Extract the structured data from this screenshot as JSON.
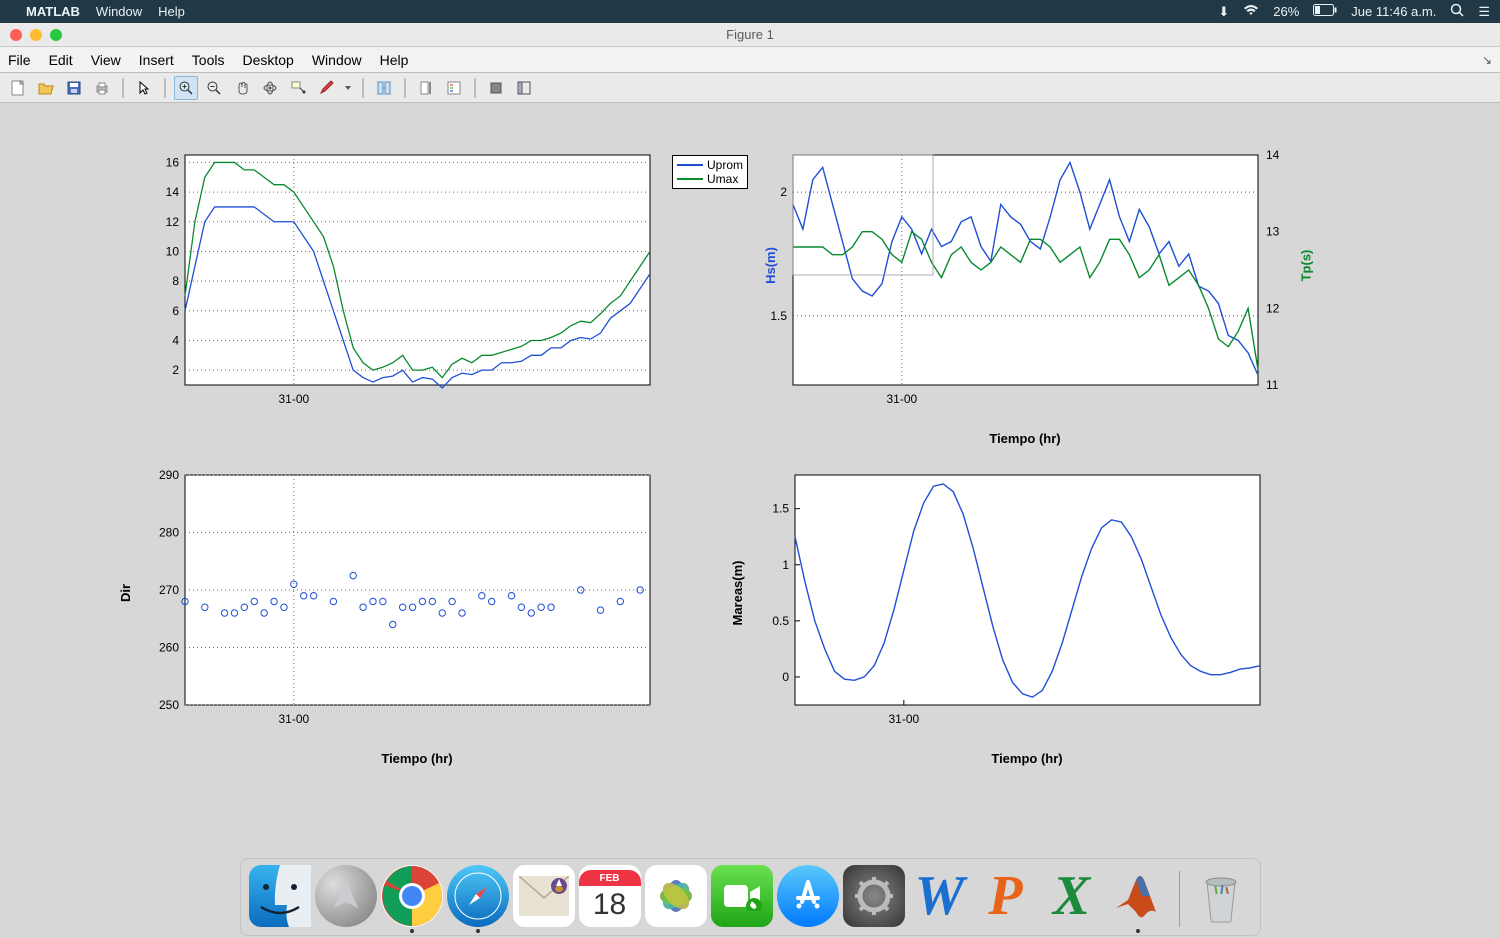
{
  "mac_menubar": {
    "app": "MATLAB",
    "menus": [
      "Window",
      "Help"
    ],
    "battery": "26%",
    "day_time": "Jue 11:46 a.m."
  },
  "window": {
    "title": "Figure 1"
  },
  "fig_menubar": {
    "items": [
      "File",
      "Edit",
      "View",
      "Insert",
      "Tools",
      "Desktop",
      "Window",
      "Help"
    ],
    "overflow": "↘"
  },
  "toolbar": {
    "items": [
      "new-figure-icon",
      "open-icon",
      "save-icon",
      "print-icon",
      "sep",
      "pointer-icon",
      "sep",
      "zoom-in-icon",
      "zoom-out-icon",
      "pan-icon",
      "rotate3d-icon",
      "data-cursor-icon",
      "brush-icon",
      "dropdown-arrow-icon",
      "sep",
      "link-axes-icon",
      "sep",
      "colorbar-icon",
      "legend-icon",
      "sep",
      "hide-tools-icon",
      "dock-icon"
    ]
  },
  "chart_data": [
    {
      "id": "wind_speed",
      "type": "line",
      "xlabel": "",
      "ylabel": "",
      "yticks": [
        2,
        4,
        6,
        8,
        10,
        12,
        14,
        16
      ],
      "xticks": [
        "31-00"
      ],
      "legend": [
        "Uprom",
        "Umax"
      ],
      "x": [
        0,
        1,
        2,
        3,
        4,
        5,
        6,
        7,
        8,
        9,
        10,
        11,
        12,
        13,
        14,
        15,
        16,
        17,
        18,
        19,
        20,
        21,
        22,
        23,
        24,
        25,
        26,
        27,
        28,
        29,
        30,
        31,
        32,
        33,
        34,
        35,
        36,
        37,
        38,
        39,
        40,
        41,
        42,
        43,
        44,
        45,
        46,
        47
      ],
      "series": [
        {
          "name": "Uprom",
          "color": "#1f4fd6",
          "values": [
            6,
            9,
            12,
            13,
            13,
            13,
            13,
            13,
            12.5,
            12,
            12,
            12,
            11,
            10,
            8,
            6,
            4,
            2,
            1.5,
            1.2,
            1.5,
            1.6,
            2,
            1.2,
            1.5,
            1.4,
            0.8,
            1.5,
            1.8,
            1.7,
            2,
            2,
            2.5,
            2.5,
            2.6,
            3,
            3,
            3.5,
            3.5,
            4,
            4.2,
            4.1,
            4.5,
            5.5,
            6,
            6.5,
            7.5,
            8.5
          ]
        },
        {
          "name": "Umax",
          "color": "#0a8a2f",
          "values": [
            7,
            12,
            15,
            16,
            16,
            16,
            15.5,
            15.5,
            15,
            14.5,
            14.5,
            14,
            13,
            12,
            11,
            9,
            6,
            3.5,
            2.5,
            2,
            2.2,
            2.5,
            3,
            2,
            2,
            2.2,
            1.5,
            2.4,
            2.8,
            2.5,
            3,
            3,
            3.2,
            3.4,
            3.6,
            4,
            4,
            4.2,
            4.5,
            5,
            5.3,
            5.2,
            5.8,
            6.5,
            7,
            8,
            9,
            10
          ]
        }
      ],
      "ylim": [
        1,
        16.5
      ]
    },
    {
      "id": "waves",
      "type": "line",
      "xlabel": "Tiempo (hr)",
      "yleft_label": "Hs(m)",
      "yright_label": "Tp(s)",
      "yleft_ticks": [
        1.5,
        2
      ],
      "yright_ticks": [
        11,
        12,
        13,
        14
      ],
      "yleft_color": "#1f4fd6",
      "yright_color": "#0a8a2f",
      "xticks": [
        "31-00"
      ],
      "x": [
        0,
        1,
        2,
        3,
        4,
        5,
        6,
        7,
        8,
        9,
        10,
        11,
        12,
        13,
        14,
        15,
        16,
        17,
        18,
        19,
        20,
        21,
        22,
        23,
        24,
        25,
        26,
        27,
        28,
        29,
        30,
        31,
        32,
        33,
        34,
        35,
        36,
        37,
        38,
        39,
        40,
        41,
        42,
        43,
        44,
        45,
        46,
        47
      ],
      "series": [
        {
          "name": "Hs",
          "axis": "left",
          "color": "#1f4fd6",
          "values": [
            1.95,
            1.85,
            2.05,
            2.1,
            1.95,
            1.8,
            1.65,
            1.6,
            1.58,
            1.63,
            1.8,
            1.9,
            1.85,
            1.75,
            1.85,
            1.78,
            1.8,
            1.88,
            1.9,
            1.78,
            1.72,
            1.95,
            1.9,
            1.87,
            1.8,
            1.77,
            1.9,
            2.05,
            2.12,
            2.0,
            1.85,
            1.95,
            2.05,
            1.9,
            1.8,
            1.93,
            1.86,
            1.75,
            1.8,
            1.7,
            1.75,
            1.62,
            1.6,
            1.55,
            1.42,
            1.4,
            1.35,
            1.26
          ],
          "ylim": [
            1.22,
            2.15
          ]
        },
        {
          "name": "Tp",
          "axis": "right",
          "color": "#0a8a2f",
          "values": [
            12.8,
            12.8,
            12.8,
            12.8,
            12.7,
            12.7,
            12.8,
            13.0,
            13.0,
            12.9,
            12.7,
            12.6,
            13.0,
            12.9,
            12.6,
            12.4,
            12.7,
            12.8,
            12.6,
            12.5,
            12.6,
            12.8,
            12.7,
            12.6,
            12.9,
            12.9,
            12.8,
            12.6,
            12.7,
            12.8,
            12.4,
            12.6,
            12.9,
            12.9,
            12.7,
            12.4,
            12.5,
            12.7,
            12.3,
            12.4,
            12.5,
            12.3,
            12.0,
            11.6,
            11.5,
            11.7,
            12.0,
            11.2
          ],
          "ylim": [
            11,
            14
          ]
        }
      ]
    },
    {
      "id": "direction",
      "type": "scatter",
      "xlabel": "Tiempo (hr)",
      "ylabel": "Dir",
      "yticks": [
        250,
        260,
        270,
        280,
        290
      ],
      "xticks": [
        "31-00"
      ],
      "color": "#1f4fd6",
      "x": [
        0,
        2,
        4,
        5,
        6,
        7,
        8,
        9,
        10,
        11,
        12,
        13,
        15,
        17,
        18,
        19,
        20,
        21,
        22,
        23,
        24,
        25,
        26,
        27,
        28,
        30,
        31,
        33,
        34,
        35,
        36,
        37,
        40,
        42,
        44,
        46
      ],
      "y": [
        268,
        267,
        266,
        266,
        267,
        268,
        266,
        268,
        267,
        271,
        269,
        269,
        268,
        272.5,
        267,
        268,
        268,
        264,
        267,
        267,
        268,
        268,
        266,
        268,
        266,
        269,
        268,
        269,
        267,
        266,
        267,
        267,
        270,
        266.5,
        268,
        270
      ],
      "ylim": [
        250,
        290
      ]
    },
    {
      "id": "tide",
      "type": "line",
      "xlabel": "Tiempo (hr)",
      "ylabel": "Mareas(m)",
      "yticks": [
        0,
        0.5,
        1,
        1.5
      ],
      "xticks": [
        "31-00"
      ],
      "color": "#1f4fd6",
      "x": [
        0,
        1,
        2,
        3,
        4,
        5,
        6,
        7,
        8,
        9,
        10,
        11,
        12,
        13,
        14,
        15,
        16,
        17,
        18,
        19,
        20,
        21,
        22,
        23,
        24,
        25,
        26,
        27,
        28,
        29,
        30,
        31,
        32,
        33,
        34,
        35,
        36,
        37,
        38,
        39,
        40,
        41,
        42,
        43,
        44,
        45,
        46,
        47
      ],
      "y": [
        1.25,
        0.85,
        0.5,
        0.25,
        0.05,
        -0.02,
        -0.03,
        0.0,
        0.1,
        0.3,
        0.6,
        0.95,
        1.3,
        1.55,
        1.7,
        1.72,
        1.65,
        1.45,
        1.15,
        0.8,
        0.45,
        0.15,
        -0.05,
        -0.15,
        -0.18,
        -0.12,
        0.05,
        0.3,
        0.6,
        0.9,
        1.15,
        1.33,
        1.4,
        1.38,
        1.25,
        1.05,
        0.8,
        0.55,
        0.35,
        0.2,
        0.1,
        0.05,
        0.02,
        0.02,
        0.04,
        0.07,
        0.08,
        0.1
      ],
      "ylim": [
        -0.25,
        1.8
      ]
    }
  ],
  "dock": {
    "apps": [
      "finder",
      "launchpad",
      "chrome",
      "safari",
      "mail",
      "calendar",
      "photos",
      "facetime",
      "appstore",
      "settings",
      "word",
      "powerpoint",
      "excel",
      "matlab"
    ],
    "calendar": {
      "month": "FEB",
      "day": "18"
    },
    "running": [
      "chrome",
      "safari",
      "matlab"
    ]
  }
}
